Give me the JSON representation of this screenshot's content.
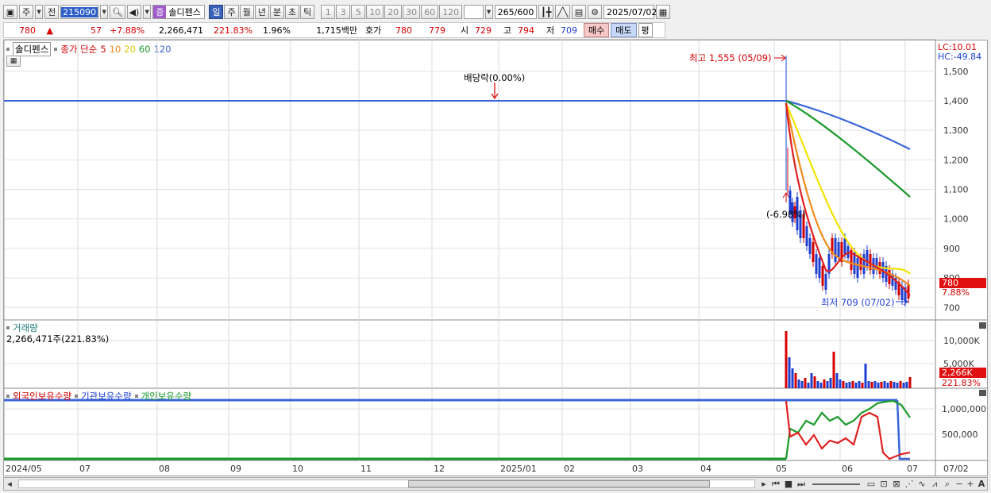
{
  "toolbar": {
    "tab_week": "주",
    "tab_prev": "전",
    "code": "215090",
    "badge": "증",
    "name": "솔디펜스",
    "periods": [
      "일",
      "주",
      "월",
      "년",
      "분",
      "초",
      "틱"
    ],
    "selected_period": "일",
    "nums": [
      "1",
      "3",
      "5",
      "10",
      "20",
      "30",
      "60",
      "120"
    ],
    "count": "265",
    "count_total": "/600",
    "date": "2025/07/02"
  },
  "quote": {
    "price": "780",
    "arrow": "▲",
    "change": "57",
    "change_pct": "+7.88%",
    "volume": "2,266,471",
    "volume_pct": "221.83%",
    "turnover_pct": "1.96%",
    "amount": "1,715백만",
    "hoga_label": "호가",
    "ask": "780",
    "bid": "779",
    "open_label": "시",
    "open": "729",
    "high_label": "고",
    "high": "794",
    "low_label": "저",
    "low": "709",
    "buy": "매수",
    "sell": "매도",
    "avg": "평"
  },
  "price_panel": {
    "legend_name": "솔디펜스",
    "legend_ma": "종가 단순",
    "ma_periods": [
      "5",
      "10",
      "20",
      "60",
      "120"
    ],
    "lc": "LC:10.01",
    "hc": "HC:-49.84",
    "y_ticks": [
      "1,500",
      "1,400",
      "1,300",
      "1,200",
      "1,100",
      "1,000",
      "900",
      "800",
      "700"
    ],
    "dividend": "배당락(0.00%)",
    "high_note": "최고 1,555 (05/09)",
    "low_note": "최저 709 (07/02)",
    "drop_note": "(-6.98%)",
    "last_price": "780",
    "last_pct": "7.88%"
  },
  "volume_panel": {
    "title": "거래량",
    "value": "2,266,471주(221.83%)",
    "y_ticks": [
      "10,000K",
      "5,000K"
    ],
    "last": "2,266K",
    "last_pct": "221.83%"
  },
  "holding_panel": {
    "legends": [
      "외국인보유수량",
      "기관보유수량",
      "개인보유수량"
    ],
    "y_ticks": [
      "1,000,000",
      "500,000"
    ]
  },
  "x_axis": [
    "2024/05",
    "07",
    "08",
    "09",
    "10",
    "11",
    "12",
    "2025/01",
    "02",
    "03",
    "04",
    "05",
    "06",
    "07"
  ],
  "x_axis_last": "07/02",
  "colors": {
    "red": "#d40000",
    "blue": "#1f3fd0",
    "ma5": "#e02020",
    "ma10": "#f08a1a",
    "ma20": "#f2e300",
    "ma60": "#1a9a2a",
    "ma120": "#3a66d8"
  },
  "chart_data": {
    "type": "line",
    "title": "",
    "x": [
      "2024/05",
      "07",
      "08",
      "09",
      "10",
      "11",
      "12",
      "2025/01",
      "02",
      "03",
      "04",
      "05",
      "06",
      "07"
    ],
    "ylim": [
      680,
      1560
    ],
    "series": [
      {
        "name": "5",
        "values": [
          1400,
          1400,
          1400,
          1400,
          1400,
          1400,
          1400,
          1400,
          1400,
          1400,
          1400,
          1390,
          880,
          740
        ]
      },
      {
        "name": "10",
        "values": [
          1400,
          1400,
          1400,
          1400,
          1400,
          1400,
          1400,
          1400,
          1400,
          1400,
          1400,
          1395,
          900,
          760
        ]
      },
      {
        "name": "20",
        "values": [
          1400,
          1400,
          1400,
          1400,
          1400,
          1400,
          1400,
          1400,
          1400,
          1400,
          1400,
          1398,
          960,
          815
        ]
      },
      {
        "name": "60",
        "values": [
          1400,
          1400,
          1400,
          1400,
          1400,
          1400,
          1400,
          1400,
          1400,
          1400,
          1400,
          1400,
          1320,
          1070
        ]
      },
      {
        "name": "120",
        "values": [
          1400,
          1400,
          1400,
          1400,
          1400,
          1400,
          1400,
          1400,
          1400,
          1400,
          1400,
          1400,
          1360,
          1230
        ]
      }
    ]
  }
}
